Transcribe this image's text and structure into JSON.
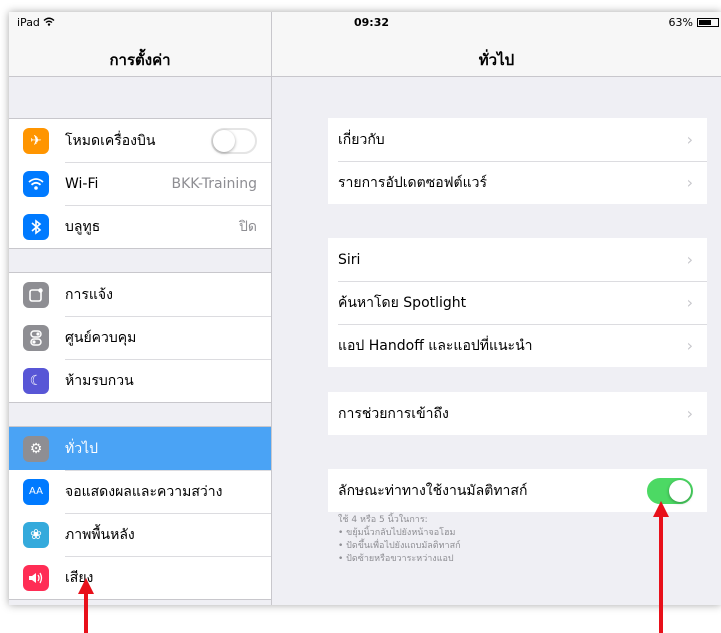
{
  "status_bar": {
    "device": "iPad",
    "time": "09:32",
    "battery": "63%"
  },
  "left_pane": {
    "title": "การตั้งค่า",
    "group1": [
      {
        "label": "โหมดเครื่องบิน",
        "icon": "airplane-icon",
        "color": "#ff9500",
        "toggle": "off"
      },
      {
        "label": "Wi-Fi",
        "icon": "wifi-icon",
        "color": "#007aff",
        "value": "BKK-Training"
      },
      {
        "label": "บลูทูธ",
        "icon": "bluetooth-icon",
        "color": "#007aff",
        "value": "ปิด"
      }
    ],
    "group2": [
      {
        "label": "การแจ้ง",
        "icon": "notifications-icon",
        "color": "#8e8e93"
      },
      {
        "label": "ศูนย์ควบคุม",
        "icon": "control-center-icon",
        "color": "#8e8e93"
      },
      {
        "label": "ห้ามรบกวน",
        "icon": "moon-icon",
        "color": "#5856d6"
      }
    ],
    "group3": [
      {
        "label": "ทั่วไป",
        "icon": "gear-icon",
        "color": "#8e8e93",
        "selected": true
      },
      {
        "label": "จอแสดงผลและความสว่าง",
        "icon": "display-icon",
        "color": "#007aff",
        "glyph": "AA"
      },
      {
        "label": "ภาพพื้นหลัง",
        "icon": "wallpaper-icon",
        "color": "#34aadc"
      },
      {
        "label": "เสียง",
        "icon": "sound-icon",
        "color": "#ff2d55"
      }
    ]
  },
  "right_pane": {
    "title": "ทั่วไป",
    "group1": [
      "เกี่ยวกับ",
      "รายการอัปเดตซอฟต์แวร์"
    ],
    "group2": [
      "Siri",
      "ค้นหาโดย Spotlight",
      "แอป Handoff และแอปที่แนะนำ"
    ],
    "group3": [
      "การช่วยการเข้าถึง"
    ],
    "group4": {
      "label": "ลักษณะท่าทางใช้งานมัลติทาสก์",
      "toggle": "on"
    },
    "footnote": [
      "ใช้ 4 หรือ 5 นิ้วในการ:",
      "• ขยุ้มนิ้วกลับไปยังหน้าจอโฮม",
      "• ปัดขึ้นเพื่อไปยังแถบมัลติทาสก์",
      "• ปัดซ้ายหรือขวาระหว่างแอป"
    ]
  },
  "colors": {
    "accent": "#4aa3f5",
    "toggle_on": "#4cd964",
    "annotation_arrow": "#e8101a"
  }
}
